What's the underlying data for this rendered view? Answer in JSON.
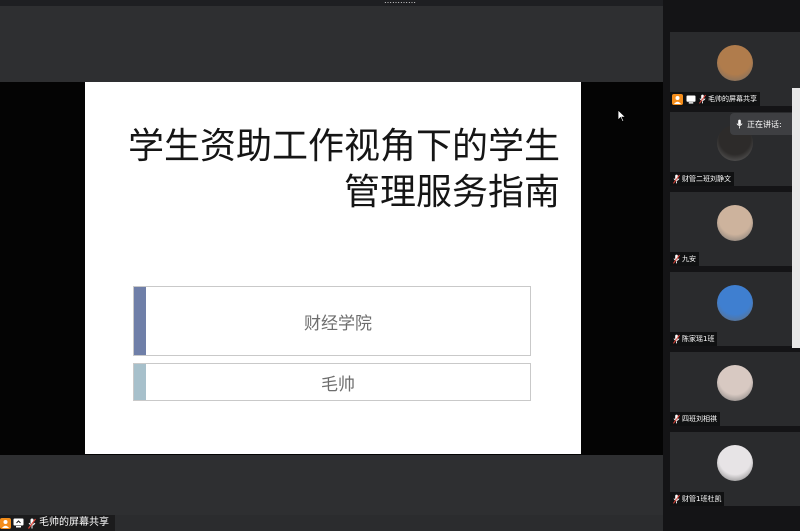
{
  "window": {
    "title": "…………"
  },
  "slide": {
    "title_line1": "学生资助工作视角下的学生",
    "title_line2": "管理服务指南",
    "college": "财经学院",
    "teacher": "毛帅"
  },
  "share_status": {
    "label": "毛帅的屏幕共享"
  },
  "speaking": {
    "label": "正在讲话:"
  },
  "participants": [
    {
      "name": "毛帅的屏幕共享",
      "avatar_color": "#b07c4c",
      "is_host": true,
      "sharing": true
    },
    {
      "name": "财管二班刘静文",
      "avatar_color": "#2d2b2a",
      "is_host": false,
      "sharing": false
    },
    {
      "name": "九安",
      "avatar_color": "#cdb39d",
      "is_host": false,
      "sharing": false
    },
    {
      "name": "陈家瑶1班",
      "avatar_color": "#3f7fd0",
      "is_host": false,
      "sharing": false
    },
    {
      "name": "四班刘相祺",
      "avatar_color": "#d8c9c2",
      "is_host": false,
      "sharing": false
    },
    {
      "name": "财管1班杜凯",
      "avatar_color": "#e7e4e6",
      "is_host": false,
      "sharing": false
    }
  ],
  "colors": {
    "host_badge": "#f38d1b",
    "slide_bar_primary": "#6f7fa8",
    "slide_bar_secondary": "#a7c0cb",
    "tile_bg": "#2a2b2d"
  },
  "icons": [
    "host-person-icon",
    "screen-share-icon",
    "mic-icon",
    "mouse-cursor-icon"
  ]
}
